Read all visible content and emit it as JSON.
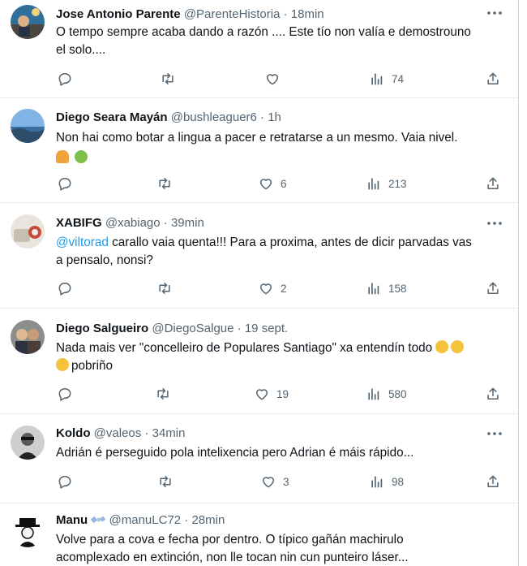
{
  "tweets": [
    {
      "name": "Jose Antonio Parente",
      "handle": "@ParenteHistoria",
      "separator": "·",
      "time": "18min",
      "text_line1": "O tempo sempre acaba dando a razón .... Este tío non valía e demostrouno",
      "text_line2": "el solo....",
      "replies": "",
      "retweets": "",
      "likes": "",
      "views": "74"
    },
    {
      "name": "Diego Seara Mayán",
      "handle": "@bushleaguer6",
      "separator": "·",
      "time": "1h",
      "text_line1": "Non hai como botar a lingua a pacer e retratarse a un mesmo. Vaia nivel.",
      "emojis": [
        "person-gesturing-icon",
        "nauseated-face-icon"
      ],
      "replies": "",
      "retweets": "",
      "likes": "6",
      "views": "213"
    },
    {
      "name": "XABIFG",
      "handle": "@xabiago",
      "separator": "·",
      "time": "39min",
      "mention": "@viltorad",
      "text_line1_rest": " carallo vaia quenta!!! Para a proxima, antes de dicir parvadas vas",
      "text_line2": "a pensalo, nonsi?",
      "replies": "",
      "retweets": "",
      "likes": "2",
      "views": "158"
    },
    {
      "name": "Diego Salgueiro",
      "handle": "@DiegoSalgue",
      "separator": "·",
      "time": "19 sept.",
      "text_line1": "Nada mais ver \"concelleiro de Populares Santiago\" xa entendín todo",
      "text_line2": "pobriño",
      "emojis": [
        "tears-of-joy-icon",
        "tears-of-joy-icon",
        "tears-of-joy-icon"
      ],
      "replies": "",
      "retweets": "",
      "likes": "19",
      "views": "580"
    },
    {
      "name": "Koldo",
      "handle": "@valeos",
      "separator": "·",
      "time": "34min",
      "text_line1": "Adrián é perseguido pola intelixencia pero Adrian é máis rápido...",
      "replies": "",
      "retweets": "",
      "likes": "3",
      "views": "98"
    },
    {
      "name": "Manu",
      "handle": "@manuLC72",
      "separator": "·",
      "time": "28min",
      "text_line1": "Volve para a cova e fecha por dentro. O típico gañán machirulo",
      "text_line2": "acomplexado en extinción, non lle tocan nin cun punteiro láser...",
      "name_emoji": "satellite-icon"
    }
  ],
  "colors": {
    "text": "#0f1419",
    "secondary": "#536471",
    "link": "#1d9bf0",
    "divider": "#e6ecf0"
  },
  "icons": [
    "reply-icon",
    "retweet-icon",
    "like-icon",
    "views-icon",
    "share-icon",
    "more-icon"
  ]
}
